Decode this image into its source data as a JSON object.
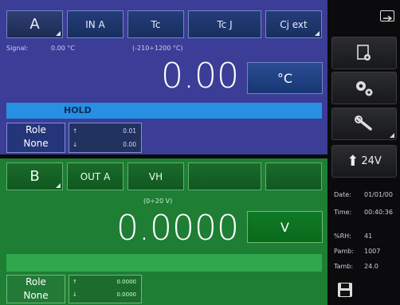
{
  "panel_a": {
    "tabs": [
      {
        "label": "A",
        "selected": true
      },
      {
        "label": "IN A"
      },
      {
        "label": "Tc"
      },
      {
        "label": "Tc J"
      },
      {
        "label": "Cj ext"
      }
    ],
    "signal_label": "Signal:",
    "signal_value": "0.00 °C",
    "range": "(-210÷1200 °C)",
    "reading": "0.00",
    "unit": "°C",
    "hold_label": "HOLD",
    "role_line1": "Role",
    "role_line2": "None",
    "range_box": {
      "up": "0.01",
      "down": "0.00"
    }
  },
  "panel_b": {
    "tabs": [
      {
        "label": "B",
        "selected": true
      },
      {
        "label": "OUT A"
      },
      {
        "label": "VH"
      },
      {
        "label": ""
      },
      {
        "label": ""
      }
    ],
    "range": "(0÷20 V)",
    "reading": "0.0000",
    "unit": "V",
    "role_line1": "Role",
    "role_line2": "None",
    "range_box": {
      "up": "0.0000",
      "down": "0.0000"
    }
  },
  "sidebar": {
    "power_label": "24V",
    "date_label": "Date:",
    "date_value": "01/01/00",
    "time_label": "Time:",
    "time_value": "00:40:36",
    "rh_label": "%RH:",
    "rh_value": "41",
    "pamb_label": "Pamb:",
    "pamb_value": "1007",
    "tamb_label": "Tamb:",
    "tamb_value": "24.0"
  },
  "colors": {
    "panel_a_bg": "#3c3d96",
    "panel_b_bg": "#1e7e34",
    "hold_bar": "#2790e2",
    "sidebar_bg": "#0b0b0d"
  }
}
